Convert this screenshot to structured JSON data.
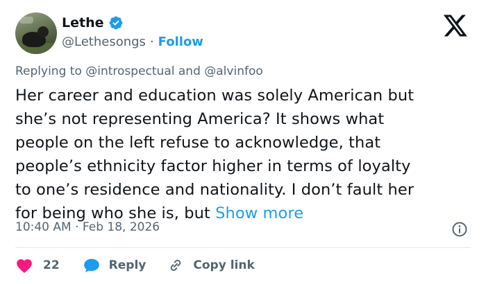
{
  "author": {
    "name": "Lethe",
    "handle": "@Lethesongs",
    "separator": "·",
    "follow_label": "Follow",
    "verified": true
  },
  "icons": {
    "verified": "verified-badge-icon",
    "platform": "x-logo-icon",
    "info": "info-icon",
    "like": "heart-icon",
    "reply": "reply-bubble-icon",
    "copy": "link-icon"
  },
  "colors": {
    "accent": "#1d9bf0",
    "like": "#f91880",
    "muted": "#536471",
    "text": "#0f1419"
  },
  "reply_context": {
    "prefix": "Replying to",
    "mention_1": "@introspectual",
    "conjunction": "and",
    "mention_2": "@alvinfoo"
  },
  "tweet": {
    "lines": [
      "Her career and education was solely American but",
      "she’s not representing America?  It shows what",
      "people on the left refuse to acknowledge, that",
      "people’s ethnicity factor higher in terms of loyalty",
      "to one’s residence and nationality. I don’t fault her",
      "for being who she is, but"
    ],
    "show_more": "Show more"
  },
  "timestamp": {
    "time": "10:40 AM",
    "separator": "·",
    "date": "Feb 18, 2026"
  },
  "actions": {
    "like_count": "22",
    "reply_label": "Reply",
    "copy_label": "Copy link"
  }
}
